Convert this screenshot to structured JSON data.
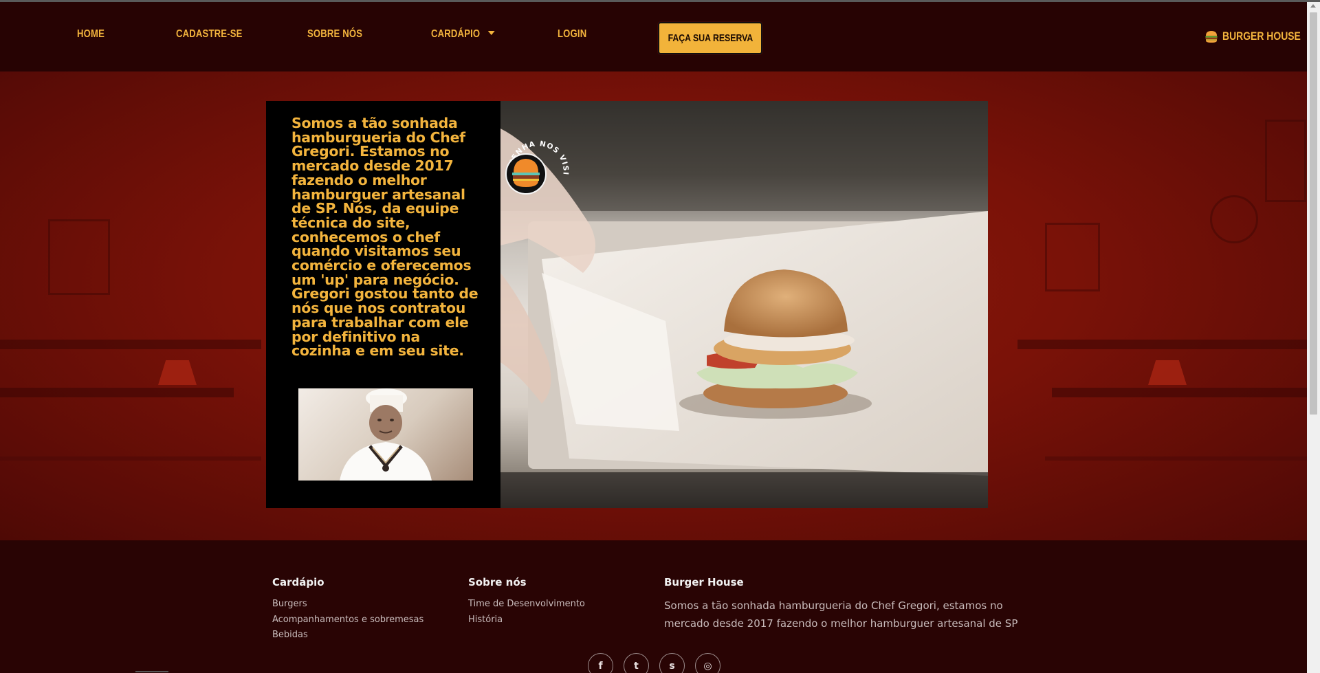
{
  "navbar": {
    "items": [
      {
        "label": "HOME"
      },
      {
        "label": "CADASTRE-SE"
      },
      {
        "label": "SOBRE NÓS"
      },
      {
        "label": "CARDÁPIO"
      },
      {
        "label": "LOGIN"
      }
    ],
    "reserve_label": "FAÇA SUA RESERVA",
    "brand": "BURGER HOUSE",
    "brand_icon": "burger-icon"
  },
  "hero": {
    "text": "Somos a tão sonhada hamburgueria do Chef Gregori. Estamos no mercado desde 2017 fazendo o melhor hamburguer artesanal de SP. Nós, da equipe técnica do site, conhecemos o chef quando visitamos seu comércio e oferecemos um 'up' para negócio. Gregori gostou tanto de nós que nos contratou para trabalhar com ele por definitivo na cozinha e em seu site.",
    "stamp_text": "VENHA NOS VISITAR!",
    "chef_photo": "chef-photo",
    "burger_photo": "burger-photo"
  },
  "footer": {
    "cardapio": {
      "title": "Cardápio",
      "links": [
        "Burgers",
        "Acompanhamentos e sobremesas",
        "Bebidas"
      ]
    },
    "sobre": {
      "title": "Sobre nós",
      "links": [
        "Time de Desenvolvimento",
        "História"
      ]
    },
    "brand": {
      "title": "Burger House",
      "description": "Somos a tão sonhada hamburgueria do Chef Gregori, estamos no mercado desde 2017 fazendo o melhor hamburguer artesanal de SP"
    },
    "socials": [
      {
        "icon": "facebook-icon",
        "glyph": "f"
      },
      {
        "icon": "twitter-icon",
        "glyph": "t"
      },
      {
        "icon": "snapchat-icon",
        "glyph": "s"
      },
      {
        "icon": "instagram-icon",
        "glyph": "◎"
      }
    ]
  },
  "colors": {
    "accent": "#f3b43d",
    "nav_bg": "#270303",
    "hero_bg": "#7a1208",
    "footer_bg": "#290404"
  }
}
